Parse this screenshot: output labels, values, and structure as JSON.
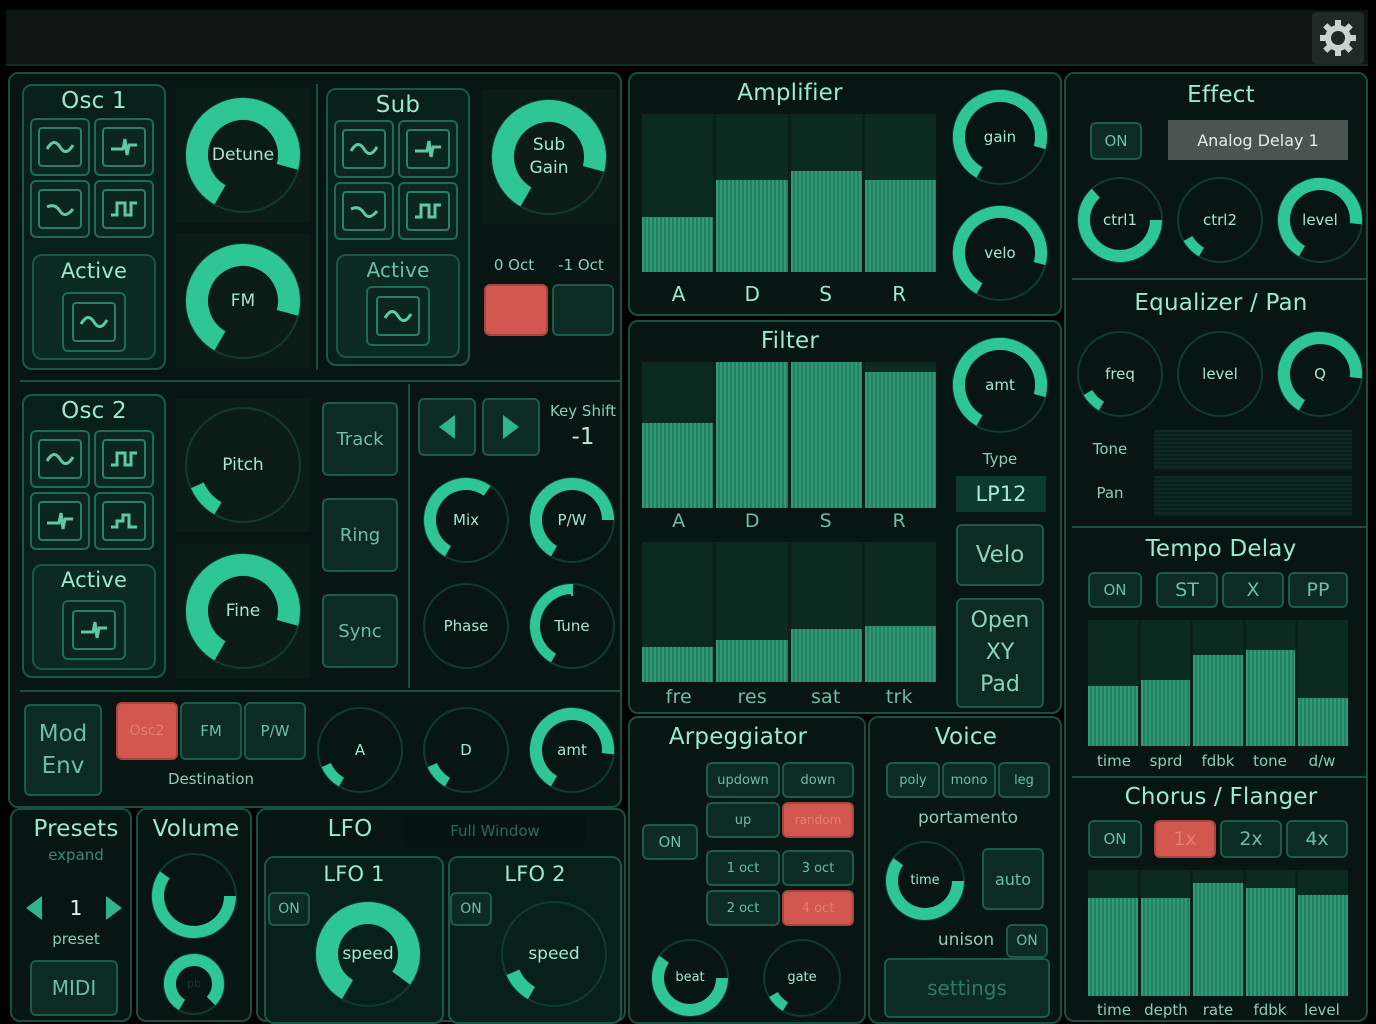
{
  "settings_icon": "gear-icon",
  "osc1": {
    "title": "Osc 1",
    "active_label": "Active",
    "detune": "Detune",
    "fm": "FM"
  },
  "sub": {
    "title": "Sub",
    "active_label": "Active",
    "gain": "Sub\nGain",
    "oct0": "0 Oct",
    "octm1": "-1 Oct"
  },
  "osc2": {
    "title": "Osc 2",
    "active_label": "Active",
    "pitch": "Pitch",
    "fine": "Fine",
    "track": "Track",
    "ring": "Ring",
    "sync": "Sync",
    "keyshift_label": "Key Shift",
    "keyshift_value": "-1",
    "mix": "Mix",
    "pw": "P/W",
    "phase": "Phase",
    "tune": "Tune"
  },
  "modenv": {
    "title": "Mod\nEnv",
    "dest": [
      "Osc2",
      "FM",
      "P/W"
    ],
    "dest_label": "Destination",
    "a": "A",
    "d": "D",
    "amt": "amt"
  },
  "presets": {
    "title": "Presets",
    "expand": "expand",
    "number": "1",
    "preset": "preset",
    "midi": "MIDI"
  },
  "volume": {
    "title": "Volume",
    "pb": "pb"
  },
  "lfo": {
    "title": "LFO",
    "window": "Full Window",
    "lfo1": "LFO 1",
    "lfo2": "LFO 2",
    "on": "ON",
    "speed": "speed"
  },
  "amp": {
    "title": "Amplifier",
    "labels": [
      "A",
      "D",
      "S",
      "R"
    ],
    "values": [
      0.35,
      0.58,
      0.64,
      0.58
    ],
    "gain": "gain",
    "velo": "velo"
  },
  "filter": {
    "title": "Filter",
    "env_labels": [
      "A",
      "D",
      "S",
      "R"
    ],
    "env_values": [
      0.58,
      1.0,
      1.0,
      0.93
    ],
    "labels2": [
      "fre",
      "res",
      "sat",
      "trk"
    ],
    "values2": [
      0.25,
      0.3,
      0.38,
      0.4
    ],
    "amt": "amt",
    "type_label": "Type",
    "type": "LP12",
    "velo": "Velo",
    "xy": "Open\nXY\nPad"
  },
  "arp": {
    "title": "Arpeggiator",
    "on": "ON",
    "buttons": [
      "updown",
      "down",
      "up",
      "random",
      "1 oct",
      "3 oct",
      "2 oct",
      "4 oct"
    ],
    "beat": "beat",
    "gate": "gate"
  },
  "voice": {
    "title": "Voice",
    "modes": [
      "poly",
      "mono",
      "leg"
    ],
    "portamento": "portamento",
    "time": "time",
    "auto": "auto",
    "unison": "unison",
    "on": "ON",
    "settings": "settings"
  },
  "effect": {
    "title": "Effect",
    "on": "ON",
    "preset": "Analog Delay 1",
    "ctrl1": "ctrl1",
    "ctrl2": "ctrl2",
    "level": "level"
  },
  "eq": {
    "title": "Equalizer / Pan",
    "freq": "freq",
    "level": "level",
    "q": "Q",
    "tone": "Tone",
    "pan": "Pan"
  },
  "tempo": {
    "title": "Tempo Delay",
    "on": "ON",
    "modes": [
      "ST",
      "X",
      "PP"
    ],
    "labels": [
      "time",
      "sprd",
      "fdbk",
      "tone",
      "d/w"
    ],
    "values": [
      0.48,
      0.52,
      0.72,
      0.76,
      0.38
    ]
  },
  "chorus": {
    "title": "Chorus / Flanger",
    "on": "ON",
    "modes": [
      "1x",
      "2x",
      "4x"
    ],
    "labels": [
      "time",
      "depth",
      "rate",
      "fdbk",
      "level"
    ],
    "values": [
      0.78,
      0.78,
      0.9,
      0.86,
      0.8
    ]
  }
}
